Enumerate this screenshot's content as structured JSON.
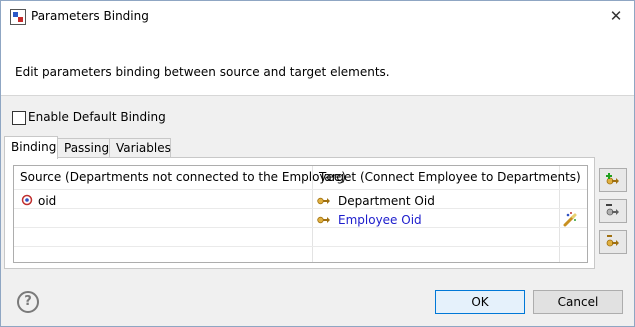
{
  "window": {
    "title": "Parameters Binding",
    "close_glyph": "✕"
  },
  "header": {
    "description": "Edit parameters binding between source and target elements."
  },
  "options": {
    "enable_default_binding": "Enable Default Binding",
    "enable_default_binding_checked": false
  },
  "tabs": [
    {
      "label": "Binding",
      "active": true
    },
    {
      "label": "Passing",
      "active": false
    },
    {
      "label": "Variables",
      "active": false
    }
  ],
  "table": {
    "columns": [
      "Source (Departments not connected to the Employee)",
      "Target (Connect Employee to Departments)"
    ],
    "rows": [
      {
        "source": "oid",
        "target": "Department Oid"
      },
      {
        "source": "",
        "target": "Employee Oid"
      }
    ]
  },
  "icons": {
    "app": "app-icon",
    "source_param": "parameter-icon",
    "target_param": "key-arrow-icon",
    "binding_action": "magic-wand-icon",
    "side_buttons": [
      "add-binding-icon",
      "edit-binding-icon",
      "remove-binding-icon"
    ],
    "help": "help-icon"
  },
  "footer": {
    "help_glyph": "?",
    "ok_label": "OK",
    "cancel_label": "Cancel"
  },
  "colors": {
    "accent": "#0078d7",
    "link_blue": "#1d1dcc",
    "panel_bg": "#f0f0f0"
  }
}
